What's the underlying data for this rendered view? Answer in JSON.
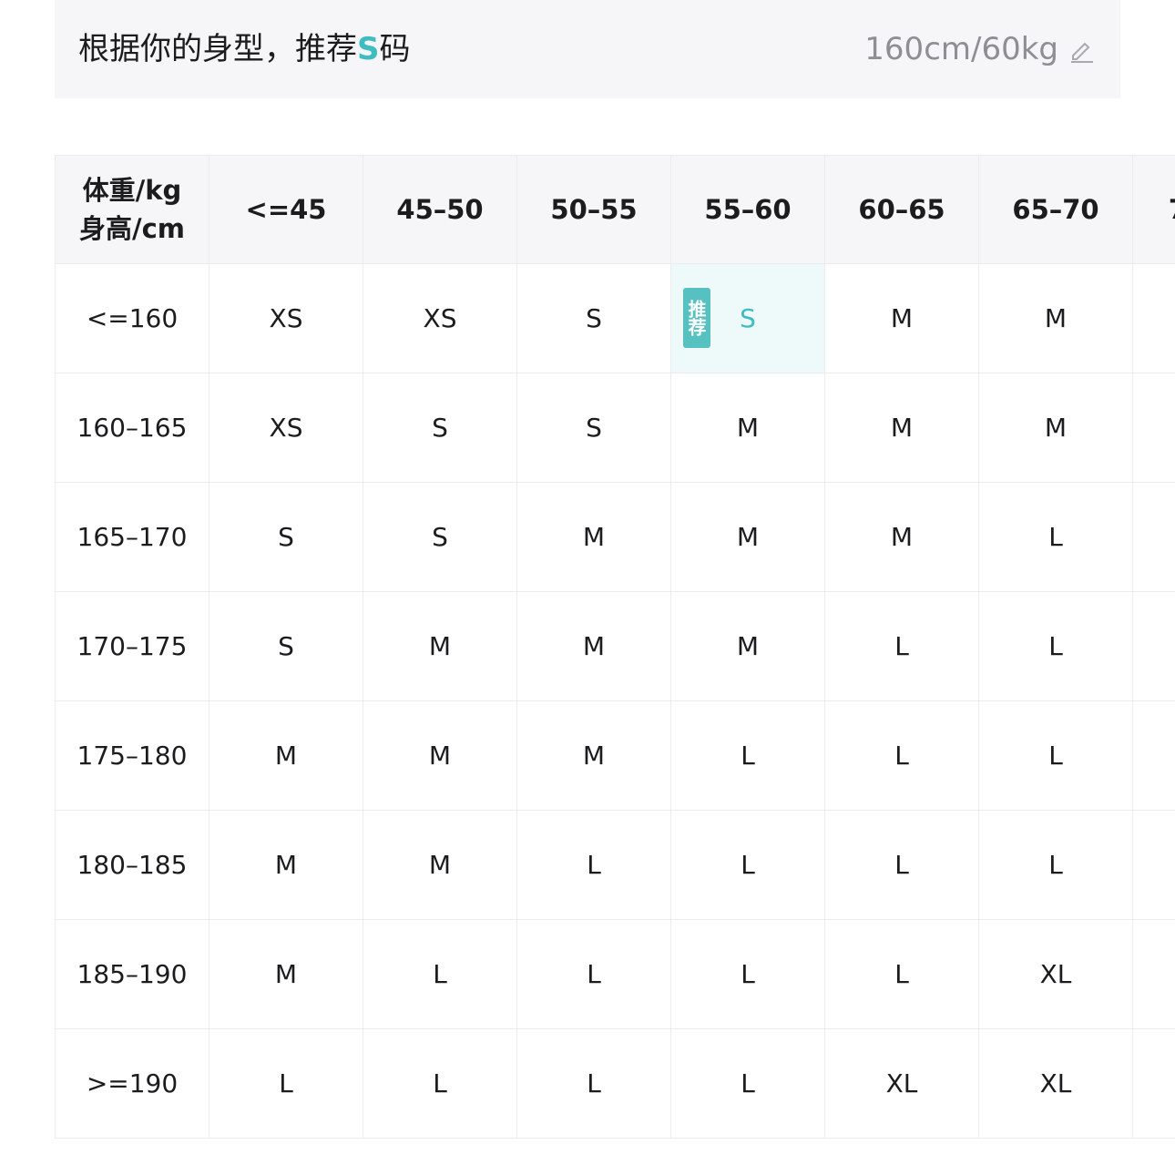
{
  "recommendation": {
    "prefix": "根据你的身型，推荐",
    "size": "S",
    "suffix": "码",
    "measurement": "160cm/60kg",
    "edit_icon": "edit-pencil-icon",
    "accent_color": "#3dbdbf"
  },
  "table": {
    "corner_top": "体重/kg",
    "corner_bottom": "身高/cm",
    "weight_columns": [
      "<=45",
      "45–50",
      "50–55",
      "55–60",
      "60–65",
      "65–70",
      "7"
    ],
    "rows": [
      {
        "height": "<=160",
        "sizes": [
          "XS",
          "XS",
          "S",
          "S",
          "M",
          "M",
          ""
        ]
      },
      {
        "height": "160–165",
        "sizes": [
          "XS",
          "S",
          "S",
          "M",
          "M",
          "M",
          ""
        ]
      },
      {
        "height": "165–170",
        "sizes": [
          "S",
          "S",
          "M",
          "M",
          "M",
          "L",
          ""
        ]
      },
      {
        "height": "170–175",
        "sizes": [
          "S",
          "M",
          "M",
          "M",
          "L",
          "L",
          ""
        ]
      },
      {
        "height": "175–180",
        "sizes": [
          "M",
          "M",
          "M",
          "L",
          "L",
          "L",
          ""
        ]
      },
      {
        "height": "180–185",
        "sizes": [
          "M",
          "M",
          "L",
          "L",
          "L",
          "L",
          ""
        ]
      },
      {
        "height": "185–190",
        "sizes": [
          "M",
          "L",
          "L",
          "L",
          "L",
          "XL",
          ""
        ]
      },
      {
        "height": ">=190",
        "sizes": [
          "L",
          "L",
          "L",
          "L",
          "XL",
          "XL",
          ""
        ]
      }
    ],
    "recommended_cell": {
      "row": 0,
      "col": 3
    },
    "recommended_badge": "推荐",
    "highlight_color": "#eefaf9"
  }
}
